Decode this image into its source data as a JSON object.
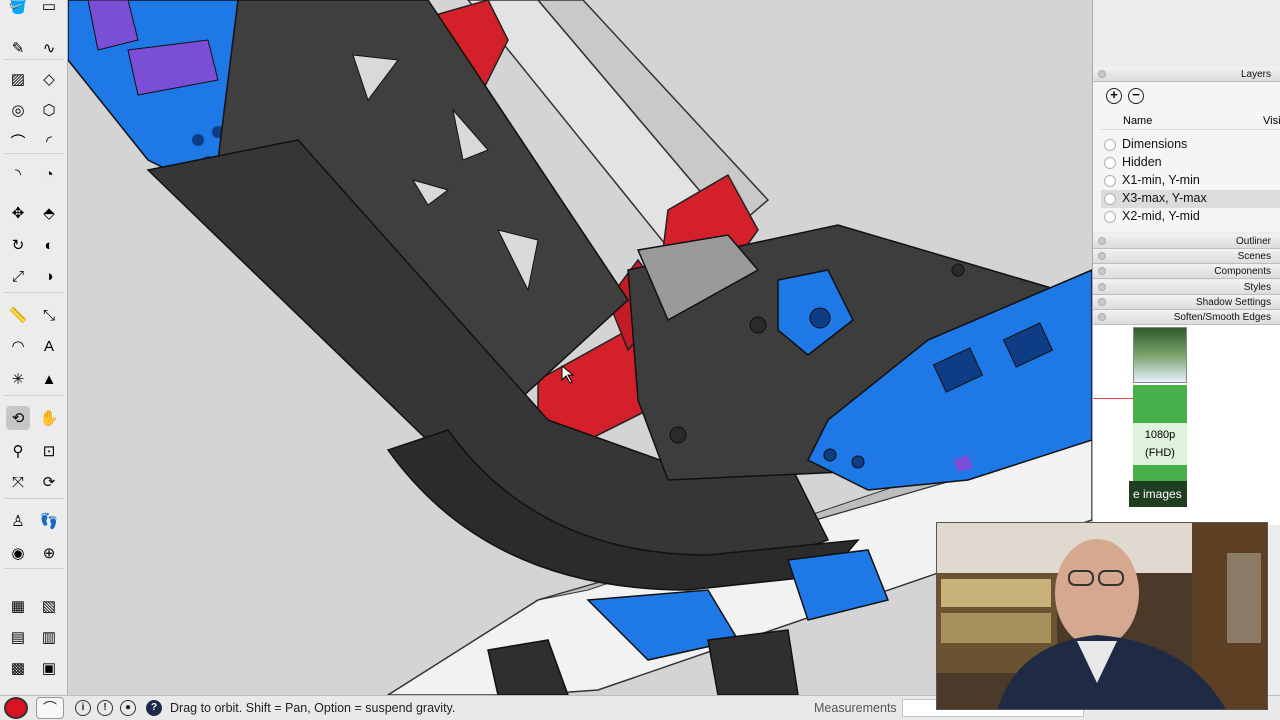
{
  "toolbar": {
    "tools": [
      {
        "name": "paint-bucket-icon",
        "glyph": "🪣"
      },
      {
        "name": "eraser-icon",
        "glyph": "▭"
      },
      {
        "name": "pencil-icon",
        "glyph": "✎"
      },
      {
        "name": "freehand-icon",
        "glyph": "∿"
      },
      {
        "name": "rectangle-icon",
        "glyph": "▨"
      },
      {
        "name": "rotated-rectangle-icon",
        "glyph": "◇"
      },
      {
        "name": "circle-icon",
        "glyph": "◎"
      },
      {
        "name": "polygon-icon",
        "glyph": "⬡"
      },
      {
        "name": "arc-icon",
        "glyph": "⌒"
      },
      {
        "name": "two-point-arc-icon",
        "glyph": "◜"
      },
      {
        "name": "three-point-arc-icon",
        "glyph": "◝"
      },
      {
        "name": "pie-icon",
        "glyph": "◔"
      },
      {
        "name": "move-icon",
        "glyph": "✥"
      },
      {
        "name": "push-pull-icon",
        "glyph": "⬘"
      },
      {
        "name": "rotate-icon",
        "glyph": "↻"
      },
      {
        "name": "follow-me-icon",
        "glyph": "◐"
      },
      {
        "name": "scale-icon",
        "glyph": "⤢"
      },
      {
        "name": "offset-icon",
        "glyph": "◑"
      },
      {
        "name": "tape-measure-icon",
        "glyph": "📏"
      },
      {
        "name": "dimension-icon",
        "glyph": "⤡"
      },
      {
        "name": "protractor-icon",
        "glyph": "◠"
      },
      {
        "name": "text-icon",
        "glyph": "A"
      },
      {
        "name": "axes-icon",
        "glyph": "✳"
      },
      {
        "name": "3d-text-icon",
        "glyph": "▲"
      },
      {
        "name": "orbit-icon",
        "glyph": "⟲"
      },
      {
        "name": "pan-icon",
        "glyph": "✋"
      },
      {
        "name": "zoom-icon",
        "glyph": "⚲"
      },
      {
        "name": "zoom-window-icon",
        "glyph": "⊡"
      },
      {
        "name": "zoom-extents-icon",
        "glyph": "⤧"
      },
      {
        "name": "previous-view-icon",
        "glyph": "⟳"
      },
      {
        "name": "position-camera-icon",
        "glyph": "♙"
      },
      {
        "name": "walk-icon",
        "glyph": "👣"
      },
      {
        "name": "look-around-icon",
        "glyph": "◉"
      },
      {
        "name": "section-plane-icon",
        "glyph": "⊕"
      },
      {
        "name": "warehouse-icon",
        "glyph": "▦"
      },
      {
        "name": "extension-warehouse-icon",
        "glyph": "▧"
      },
      {
        "name": "share-model-icon",
        "glyph": "▤"
      },
      {
        "name": "layout-icon",
        "glyph": "▥"
      },
      {
        "name": "send-to-layout-icon",
        "glyph": "▩"
      },
      {
        "name": "extension-manager-icon",
        "glyph": "▣"
      }
    ]
  },
  "layers_panel": {
    "title": "Layers",
    "add_glyph": "+",
    "remove_glyph": "−",
    "col_name": "Name",
    "col_visible": "Visi",
    "layers": [
      {
        "name": "Dimensions",
        "selected": false
      },
      {
        "name": "Hidden",
        "selected": false
      },
      {
        "name": "X1-min, Y-min",
        "selected": false
      },
      {
        "name": "X3-max, Y-max",
        "selected": true
      },
      {
        "name": "X2-mid, Y-mid",
        "selected": false
      }
    ]
  },
  "trays": [
    "Outliner",
    "Scenes",
    "Components",
    "Styles",
    "Shadow Settings",
    "Soften/Smooth Edges"
  ],
  "background_browser": {
    "res_label_1": "1080p",
    "res_label_2": "(FHD)",
    "button_label": "e images"
  },
  "statusbar": {
    "hint": "Drag to orbit. Shift = Pan, Option = suspend gravity.",
    "measurements_label": "Measurements",
    "icon_info": "i",
    "icon_info2": "!",
    "icon_user": "●",
    "icon_help": "?"
  },
  "colors": {
    "panel_black": "#3c3c3c",
    "accent_blue": "#1e78e6",
    "accent_red": "#d3202b",
    "rod_white": "#e9e9e9"
  }
}
